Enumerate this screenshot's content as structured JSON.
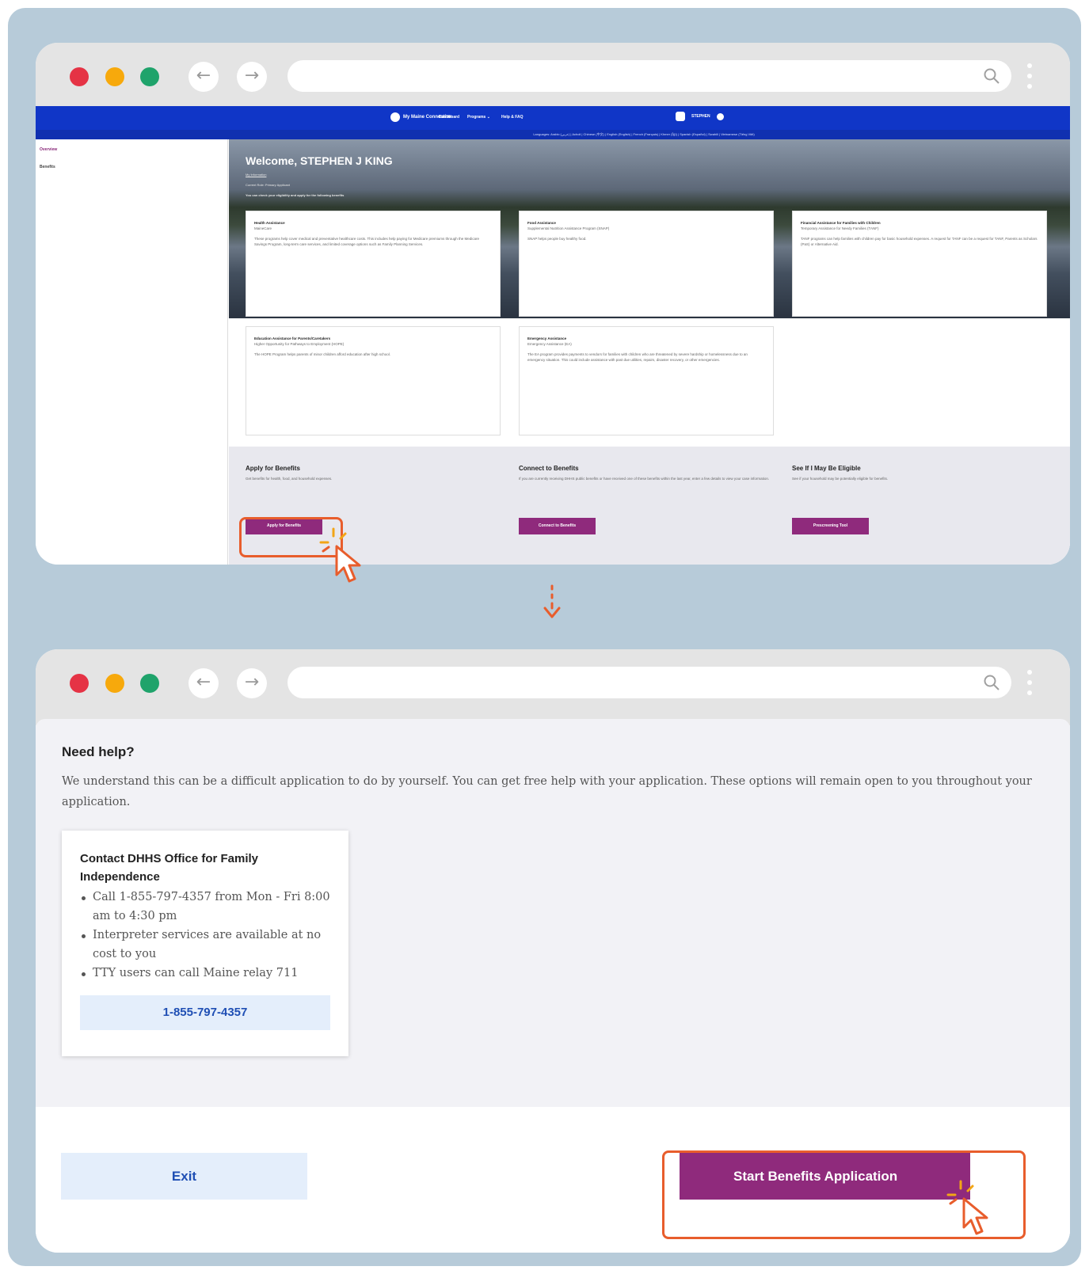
{
  "browser": {
    "back_icon": "←",
    "forward_icon": "→"
  },
  "portal": {
    "logo_text": "My Maine Connection",
    "menu": [
      "Dashboard",
      "Programs ⌄",
      "Help & FAQ"
    ],
    "user_name": "STEPHEN",
    "languages": "Languages: Arabic (عربي) | Acholi | Chinese (中文) | English (English) | French (Français) | Khmer (ខ្មែរ) | Spanish (Español) | Swahili | Vietnamese (Tiếng Việt)",
    "sidebar": [
      "Overview",
      "Benefits"
    ],
    "welcome": "Welcome, STEPHEN J KING",
    "my_information": "My Information",
    "current_role": "Current Role: Primary Applicant",
    "check_eligibility": "You can check your eligibility and apply for the following benefits",
    "cards": [
      {
        "title": "Health Assistance",
        "subtitle": "MaineCare",
        "desc": "These programs help cover medical and preventative healthcare costs. This includes help paying for Medicare premiums through the Medicare Savings Program, long-term care services, and limited coverage options such as Family Planning Services."
      },
      {
        "title": "Food Assistance",
        "subtitle": "Supplemental Nutrition Assistance Program (SNAP)",
        "desc": "SNAP helps people buy healthy food."
      },
      {
        "title": "Financial Assistance for Families with Children",
        "subtitle": "Temporary Assistance for Needy Families (TANF)",
        "desc": "TANF programs can help families with children pay for basic household expenses. A request for TANF can be a request for TANF, Parents as Scholars (PaS) or Alternative Aid."
      },
      {
        "title": "Education Assistance for Parents/Caretakers",
        "subtitle": "Higher Opportunity for Pathways to Employment (HOPE)",
        "desc": "The HOPE Program helps parents of minor children afford education after high school."
      },
      {
        "title": "Emergency Assistance",
        "subtitle": "Emergency Assistance (EA)",
        "desc": "The EA program provides payments to vendors for families with children who are threatened by severe hardship or homelessness due to an emergency situation. This could include assistance with past due utilities, repairs, disaster recovery, or other emergencies."
      }
    ],
    "actions": [
      {
        "title": "Apply for Benefits",
        "desc": "Get benefits for health, food, and household expenses.",
        "button": "Apply for Benefits"
      },
      {
        "title": "Connect to Benefits",
        "desc": "If you are currently receiving DHHS public benefits or have received one of these benefits within the last year, enter a few details to view your case information.",
        "button": "Connect to Benefits"
      },
      {
        "title": "See If I May Be Eligible",
        "desc": "See if your household may be potentially eligible for benefits.",
        "button": "Prescreening Tool"
      }
    ]
  },
  "help_page": {
    "heading": "Need help?",
    "intro": "We understand this can be a difficult application to do by yourself. You can get free help with your application. These options will remain open to you throughout your application.",
    "card_title": "Contact DHHS Office for Family Independence",
    "bullets": [
      "Call 1-855-797-4357 from Mon - Fri 8:00 am to 4:30 pm",
      "Interpreter services are available at no cost to you",
      "TTY users can call Maine relay 711"
    ],
    "phone_button": "1-855-797-4357",
    "exit_button": "Exit",
    "start_button": "Start Benefits Application"
  },
  "colors": {
    "page_bg": "#b7cbd9",
    "portal_blue": "#1036c7",
    "brand_purple": "#8f2a7c",
    "highlight_orange": "#e85d2c"
  }
}
